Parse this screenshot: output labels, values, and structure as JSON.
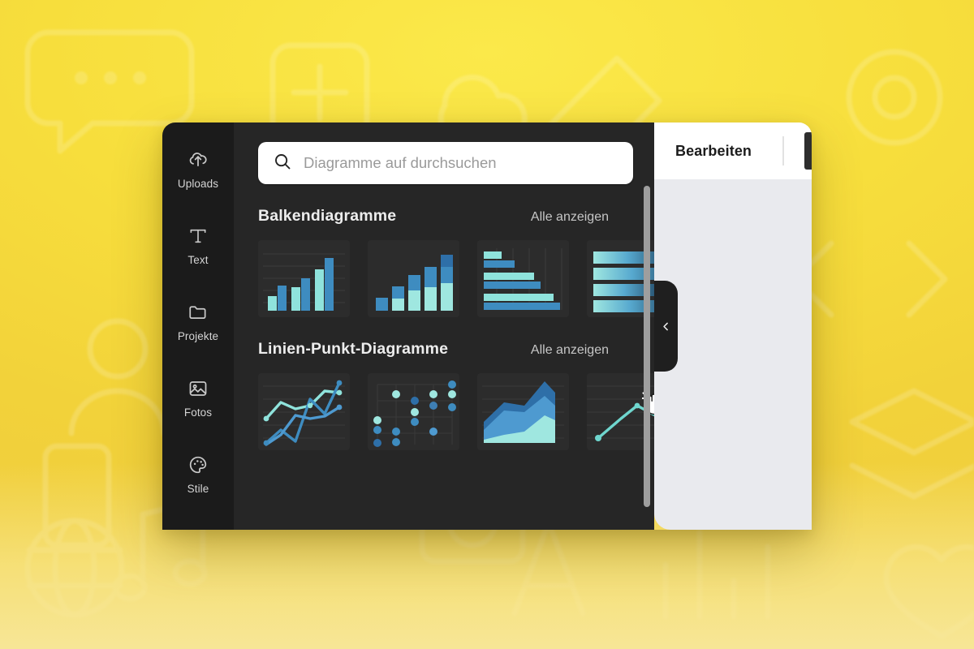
{
  "background": {
    "base_color": "#F6DC3B",
    "fade_color": "#F8E9A0"
  },
  "sidebar": {
    "items": [
      {
        "label": "Uploads",
        "icon": "cloud-upload-icon"
      },
      {
        "label": "Text",
        "icon": "text-t-icon"
      },
      {
        "label": "Projekte",
        "icon": "folder-icon"
      },
      {
        "label": "Fotos",
        "icon": "image-icon"
      },
      {
        "label": "Stile",
        "icon": "palette-icon"
      }
    ]
  },
  "search": {
    "placeholder": "Diagramme auf durchsuchen",
    "value": "",
    "icon": "search-icon"
  },
  "sections": [
    {
      "title": "Balkendiagramme",
      "link_label": "Alle anzeigen",
      "thumbs": [
        {
          "name": "grouped-bar-chart"
        },
        {
          "name": "stacked-bar-chart"
        },
        {
          "name": "horizontal-bar-chart"
        },
        {
          "name": "horizontal-gradient-bar-chart"
        }
      ]
    },
    {
      "title": "Linien-Punkt-Diagramme",
      "link_label": "Alle anzeigen",
      "thumbs": [
        {
          "name": "line-chart-with-markers"
        },
        {
          "name": "dot-plot-chart"
        },
        {
          "name": "stacked-area-chart"
        },
        {
          "name": "simple-line-chart"
        }
      ]
    }
  ],
  "edit_panel": {
    "tab_label": "Bearbeiten",
    "collapse_icon": "chevron-left-icon"
  },
  "cursor": {
    "icon": "grabbing-hand-cursor"
  },
  "chart_data": [
    {
      "id": "grouped-bar-chart",
      "type": "bar",
      "title": "",
      "categories": [
        "1",
        "2",
        "3",
        "4"
      ],
      "grid": true,
      "ylim": [
        0,
        100
      ],
      "series": [
        {
          "name": "A",
          "color": "#8FE3DC",
          "values": [
            18,
            38,
            68,
            92
          ]
        },
        {
          "name": "B",
          "color": "#3E8CC0",
          "values": [
            38,
            52,
            100,
            0
          ]
        }
      ]
    },
    {
      "id": "stacked-bar-chart",
      "type": "bar",
      "title": "",
      "categories": [
        "1",
        "2",
        "3",
        "4",
        "5"
      ],
      "grid": false,
      "ylim": [
        0,
        100
      ],
      "series": [
        {
          "name": "low",
          "color": "#9FE7E0",
          "values": [
            0,
            22,
            38,
            44,
            50
          ]
        },
        {
          "name": "mid",
          "color": "#3E8CC0",
          "values": [
            18,
            22,
            26,
            32,
            26
          ]
        },
        {
          "name": "high",
          "color": "#2E6FA8",
          "values": [
            0,
            0,
            0,
            0,
            24
          ]
        }
      ]
    },
    {
      "id": "horizontal-bar-chart",
      "type": "bar",
      "title": "",
      "categories": [
        "1",
        "2",
        "3"
      ],
      "grid": true,
      "xlim": [
        0,
        100
      ],
      "series": [
        {
          "name": "A",
          "color": "#8FE3DC",
          "values": [
            20,
            58,
            86
          ]
        },
        {
          "name": "B",
          "color": "#3E8CC0",
          "values": [
            34,
            66,
            100
          ]
        }
      ]
    },
    {
      "id": "horizontal-gradient-bar-chart",
      "type": "bar",
      "title": "",
      "categories": [
        "1",
        "2",
        "3",
        "4"
      ],
      "grid": false,
      "xlim": [
        0,
        100
      ],
      "values": [
        88,
        100,
        78,
        92
      ]
    },
    {
      "id": "line-chart-with-markers",
      "type": "line",
      "title": "",
      "grid": true,
      "x": [
        0,
        1,
        2,
        3,
        4,
        5
      ],
      "series": [
        {
          "name": "A",
          "color": "#8FE3DC",
          "values": [
            42,
            66,
            58,
            62,
            86,
            84
          ]
        },
        {
          "name": "B",
          "color": "#3E8CC0",
          "values": [
            10,
            28,
            14,
            70,
            50,
            94
          ]
        },
        {
          "name": "C",
          "color": "#4E9AD0",
          "values": [
            6,
            20,
            46,
            40,
            44,
            62
          ]
        }
      ]
    },
    {
      "id": "dot-plot-chart",
      "type": "scatter",
      "title": "",
      "grid": true,
      "points": [
        {
          "x": 0,
          "y": 46,
          "color": "#9FE7E0"
        },
        {
          "x": 0,
          "y": 32,
          "color": "#3E8CC0"
        },
        {
          "x": 0,
          "y": 10,
          "color": "#2E6FA8"
        },
        {
          "x": 1,
          "y": 84,
          "color": "#9FE7E0"
        },
        {
          "x": 1,
          "y": 30,
          "color": "#3E8CC0"
        },
        {
          "x": 1,
          "y": 12,
          "color": "#3E8CC0"
        },
        {
          "x": 2,
          "y": 72,
          "color": "#2E6FA8"
        },
        {
          "x": 2,
          "y": 56,
          "color": "#9FE7E0"
        },
        {
          "x": 2,
          "y": 42,
          "color": "#3E8CC0"
        },
        {
          "x": 3,
          "y": 84,
          "color": "#9FE7E0"
        },
        {
          "x": 3,
          "y": 66,
          "color": "#3E7FB5"
        },
        {
          "x": 3,
          "y": 26,
          "color": "#4E9AD0"
        },
        {
          "x": 4,
          "y": 96,
          "color": "#3E8CC0"
        },
        {
          "x": 4,
          "y": 82,
          "color": "#9FE7E0"
        },
        {
          "x": 4,
          "y": 64,
          "color": "#3E8CC0"
        }
      ]
    },
    {
      "id": "stacked-area-chart",
      "type": "area",
      "title": "",
      "grid": true,
      "x": [
        0,
        1,
        2,
        3,
        4
      ],
      "series": [
        {
          "name": "low",
          "color": "#9FE7E0",
          "values": [
            6,
            12,
            16,
            40,
            44
          ]
        },
        {
          "name": "mid",
          "color": "#4E9AD0",
          "values": [
            22,
            46,
            44,
            64,
            62
          ]
        },
        {
          "name": "high",
          "color": "#2E6FA8",
          "values": [
            34,
            62,
            58,
            96,
            80
          ]
        }
      ]
    },
    {
      "id": "simple-line-chart",
      "type": "line",
      "title": "",
      "grid": true,
      "x": [
        0,
        1,
        2,
        3
      ],
      "series": [
        {
          "name": "A",
          "color": "#6FD6CE",
          "values": [
            12,
            56,
            44,
            62
          ]
        }
      ]
    }
  ]
}
